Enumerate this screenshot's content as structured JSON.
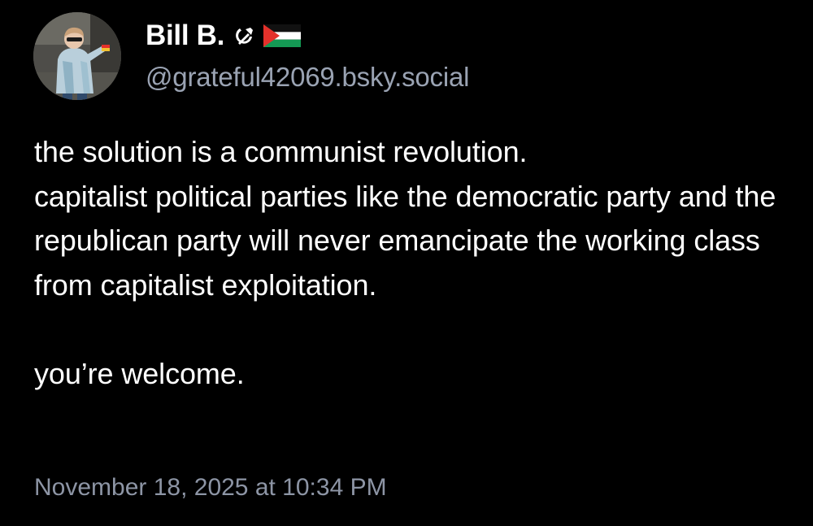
{
  "author": {
    "display_name": "Bill B.",
    "name_emojis": [
      "hammer-and-sickle-icon",
      "palestine-flag-icon"
    ],
    "handle": "@grateful42069.bsky.social",
    "avatar": "profile-photo-child-in-raincoat"
  },
  "post": {
    "text": "the solution is a communist revolution.\ncapitalist political parties like the democratic party and the republican party will never emancipate the working class from capitalist exploitation.\n\nyou’re welcome.",
    "timestamp": "November 18, 2025 at 10:34 PM"
  },
  "colors": {
    "background": "#000000",
    "text": "#ffffff",
    "handle": "#9aa3b3",
    "timestamp": "#8d95a5",
    "flag_red": "#e4312b",
    "flag_green": "#149954"
  }
}
